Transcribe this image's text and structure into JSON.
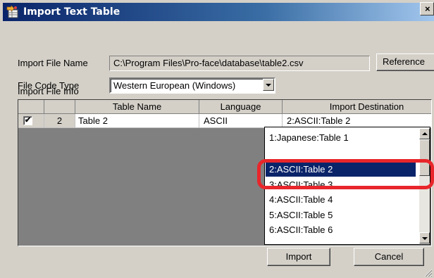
{
  "window": {
    "title": "Import Text Table",
    "close_glyph": "×",
    "icon": "import-table-icon"
  },
  "import_file_name": {
    "label": "Import File Name",
    "value": "C:\\Program Files\\Pro-face\\database\\table2.csv",
    "reference_button": "Reference"
  },
  "file_code_type": {
    "label": "File Code Type",
    "value": "Western European (Windows)"
  },
  "import_file_info": {
    "label": "Import File Info",
    "columns": [
      "Table Name",
      "Language",
      "Import Destination"
    ],
    "rows": [
      {
        "checked": true,
        "check_glyph": "✔",
        "number": "2",
        "table_name": "Table 2",
        "language": "ASCII",
        "destination": "2:ASCII:Table 2"
      }
    ]
  },
  "destination_dropdown": {
    "items": [
      "1:Japanese:Table 1",
      "2:ASCII:Table 2",
      "3:ASCII:Table 3",
      "4:ASCII:Table 4",
      "5:ASCII:Table 5",
      "6:ASCII:Table 6"
    ],
    "selected": "2:ASCII:Table 2"
  },
  "buttons": {
    "import": "Import",
    "cancel": "Cancel"
  },
  "colors": {
    "titlebar": "#0a246a",
    "selection": "#0a246a",
    "highlight_ring": "#e8262b",
    "face": "#d4d0c8"
  }
}
